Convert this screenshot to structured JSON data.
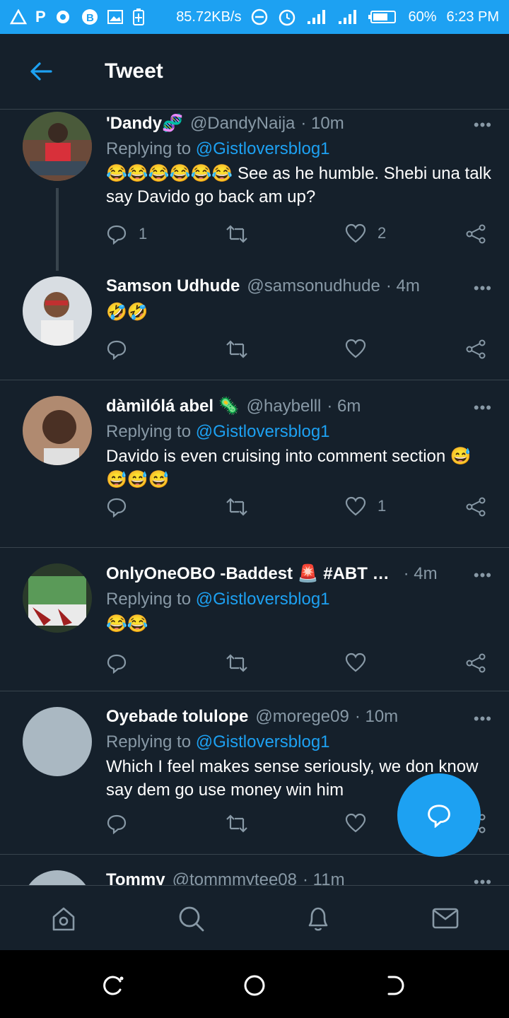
{
  "status_bar": {
    "left_icons": [
      "warning-icon",
      "p-icon",
      "chat-icon",
      "bitcoin-icon",
      "gallery-icon",
      "battery-saver-icon"
    ],
    "speed": "85.72KB/s",
    "battery": "60%",
    "time": "6:23 PM"
  },
  "header": {
    "title": "Tweet"
  },
  "tweets": [
    {
      "name": "'Dandy🧬",
      "handle": "@DandyNaija",
      "time": "· 10m",
      "replying_prefix": "Replying to ",
      "replying_to": "@Gistloversblog1",
      "text": "😂😂😂😂😂😂 See as he humble. Shebi una talk say Davido go back am up?",
      "replies": "1",
      "retweets": "",
      "likes": "2",
      "avatar_color": "#6b5a3a"
    },
    {
      "name": "Samson Udhude",
      "handle": "@samsonudhude",
      "time": "· 4m",
      "replying_prefix": "",
      "replying_to": "",
      "text": "🤣🤣",
      "replies": "",
      "retweets": "",
      "likes": "",
      "avatar_color": "#9aa3ad"
    },
    {
      "name": "dàmìlólá abel 🦠",
      "handle": "@haybelll",
      "time": "· 6m",
      "replying_prefix": "Replying to ",
      "replying_to": "@Gistloversblog1",
      "text": "Davido is even cruising into comment section 😅😅😅😅",
      "replies": "",
      "retweets": "",
      "likes": "1",
      "avatar_color": "#8a5f48"
    },
    {
      "name": "OnlyOneOBO -Baddest 🚨 #ABT …",
      "handle": "",
      "time": "· 4m",
      "replying_prefix": "Replying to ",
      "replying_to": "@Gistloversblog1",
      "text": "😂😂",
      "replies": "",
      "retweets": "",
      "likes": "",
      "avatar_color": "#3c6b3a"
    },
    {
      "name": "Oyebade tolulope",
      "handle": "@morege09",
      "time": "· 10m",
      "replying_prefix": "Replying to ",
      "replying_to": "@Gistloversblog1",
      "text": "Which I feel makes sense seriously, we don know say dem go use money win him",
      "replies": "",
      "retweets": "",
      "likes": "",
      "avatar_color": "#aab8c2"
    },
    {
      "name": "Tommy",
      "handle": "@tommmytee08",
      "time": "· 11m",
      "replying_prefix": "",
      "replying_to": "",
      "text": "",
      "replies": "",
      "retweets": "",
      "likes": "",
      "avatar_color": "#aab8c2"
    }
  ],
  "more_label": "•••",
  "tabs": [
    "home-icon",
    "search-icon",
    "notifications-icon",
    "messages-icon"
  ],
  "colors": {
    "accent": "#1da1f2",
    "background": "#15202b",
    "muted": "#8899a6",
    "divider": "#38444d"
  }
}
